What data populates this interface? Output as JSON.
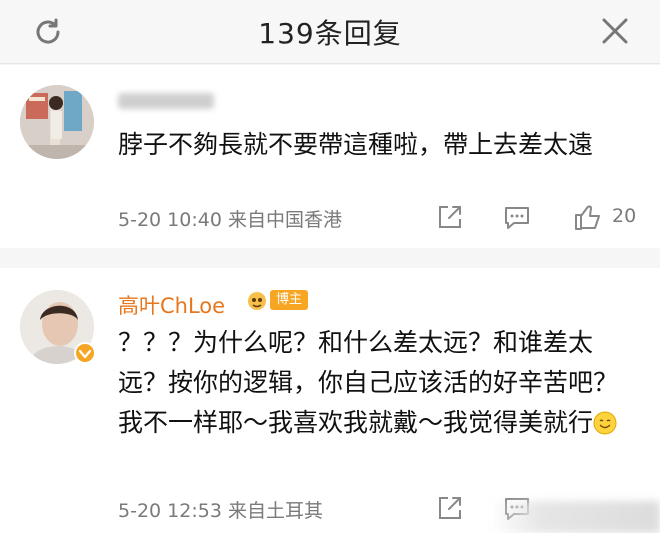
{
  "header": {
    "title": "139条回复"
  },
  "comments": [
    {
      "username": "",
      "text": "脖子不夠長就不要帶這種啦，帶上去差太遠",
      "meta": "5-20 10:40 来自中国香港",
      "likes": "20"
    },
    {
      "username": "高叶ChLoe",
      "badge": "博主",
      "text": "？？？为什么呢？和什么差太远？和谁差太远？按你的逻辑，你自己应该活的好辛苦吧？我不一样耶～我喜欢我就戴～我觉得美就行",
      "meta": "5-20 12:53 来自土耳其",
      "likes": ""
    }
  ],
  "colors": {
    "username": "#e8761c",
    "badge": "#f6a623",
    "meta": "#7a7a7a"
  },
  "icons": [
    "refresh-icon",
    "close-icon",
    "share-icon",
    "reply-icon",
    "like-icon",
    "crown-icon",
    "smile-emoji-icon",
    "verified-icon"
  ]
}
